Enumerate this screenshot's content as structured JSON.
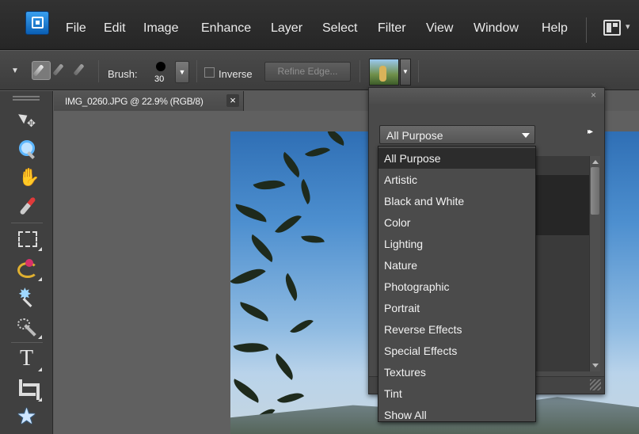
{
  "menubar": {
    "items": [
      "File",
      "Edit",
      "Image",
      "Enhance",
      "Layer",
      "Select",
      "Filter",
      "View",
      "Window",
      "Help"
    ]
  },
  "options": {
    "brush_label": "Brush:",
    "brush_size": "30",
    "inverse_label": "Inverse",
    "refine_edge_label": "Refine Edge...",
    "tools": [
      "selection-brush-icon",
      "brush-add-icon",
      "brush-subtract-icon"
    ]
  },
  "document": {
    "tab_label": "IMG_0260.JPG @ 22.9% (RGB/8)",
    "close_glyph": "×"
  },
  "toolbox": {
    "tools": [
      "move-icon",
      "zoom-icon",
      "hand-icon",
      "eyedropper-icon",
      "rectangular-marquee-icon",
      "lasso-icon",
      "magic-wand-icon",
      "quick-selection-icon",
      "type-icon",
      "crop-icon",
      "cookie-cutter-icon"
    ]
  },
  "filter_panel": {
    "close_glyph": "×",
    "more_glyph": "▸▸",
    "category_selected": "All Purpose",
    "category_options": [
      "All Purpose",
      "Artistic",
      "Black and White",
      "Color",
      "Lighting",
      "Nature",
      "Photographic",
      "Portrait",
      "Reverse Effects",
      "Special Effects",
      "Textures",
      "Tint",
      "Show All"
    ]
  },
  "colors": {
    "menubar_bg": "#2b2b2b",
    "panel_bg": "#4a4a4a",
    "dropdown_selected_bg": "#2c2c2c",
    "app_icon_blue": "#1a78d2"
  }
}
